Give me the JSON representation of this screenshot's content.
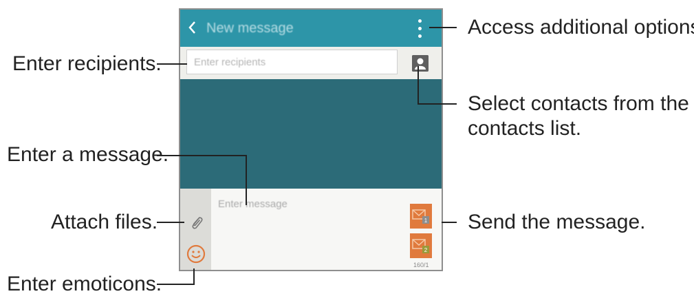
{
  "screen": {
    "title": "New message",
    "recipient_placeholder": "Enter recipients",
    "message_placeholder": "Enter message",
    "send_buttons": [
      "1",
      "2"
    ],
    "counter": "160/1"
  },
  "annotations": {
    "options": "Access additional options.",
    "recipients": "Enter recipients.",
    "contacts_line1": "Select contacts from the",
    "contacts_line2": "contacts list.",
    "message": "Enter a message.",
    "attach": "Attach files.",
    "send": "Send the message.",
    "emoticons": "Enter emoticons."
  },
  "colors": {
    "action_bar": "#2d95a8",
    "body": "#2c6b78",
    "send_button": "#e07a3d",
    "emoticon_icon": "#e07a3d"
  }
}
